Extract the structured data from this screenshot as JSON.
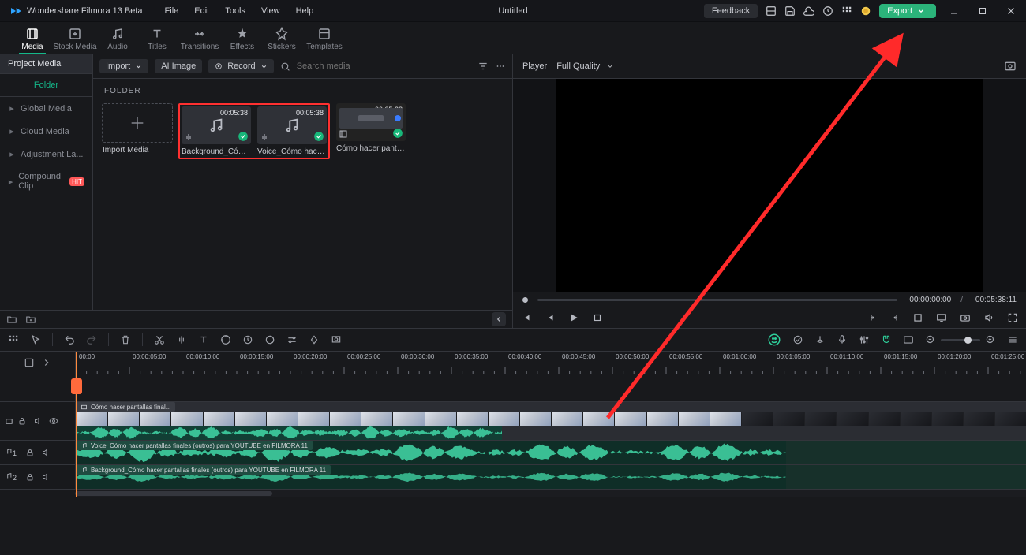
{
  "app": {
    "name": "Wondershare Filmora 13 Beta",
    "document_title": "Untitled"
  },
  "menu": [
    "File",
    "Edit",
    "Tools",
    "View",
    "Help"
  ],
  "titlebar": {
    "feedback": "Feedback",
    "export": "Export"
  },
  "tool_tabs": [
    {
      "label": "Media",
      "icon": "film"
    },
    {
      "label": "Stock Media",
      "icon": "download"
    },
    {
      "label": "Audio",
      "icon": "note"
    },
    {
      "label": "Titles",
      "icon": "text"
    },
    {
      "label": "Transitions",
      "icon": "transition"
    },
    {
      "label": "Effects",
      "icon": "sparkle"
    },
    {
      "label": "Stickers",
      "icon": "sticker"
    },
    {
      "label": "Templates",
      "icon": "template"
    }
  ],
  "side": {
    "head": "Project Media",
    "folder": "Folder",
    "items": [
      {
        "label": "Global Media"
      },
      {
        "label": "Cloud Media"
      },
      {
        "label": "Adjustment La..."
      },
      {
        "label": "Compound Clip",
        "badge": "HIT"
      }
    ]
  },
  "media_tools": {
    "import": "Import",
    "ai_image": "AI Image",
    "record": "Record",
    "search_placeholder": "Search media"
  },
  "media": {
    "folder_label": "FOLDER",
    "cards": [
      {
        "kind": "import",
        "name": "Import Media"
      },
      {
        "kind": "audio",
        "name": "Background_Cómo ha...",
        "dur": "00:05:38"
      },
      {
        "kind": "audio",
        "name": "Voice_Cómo hacer pa...",
        "dur": "00:05:38"
      },
      {
        "kind": "video",
        "name": "Cómo hacer pantallas ...",
        "dur": "00:05:38"
      }
    ]
  },
  "player": {
    "label": "Player",
    "quality": "Full Quality",
    "current": "00:00:00:00",
    "total": "00:05:38:11"
  },
  "ruler": {
    "labels": [
      "00:00",
      "00:00:05:00",
      "00:00:10:00",
      "00:00:15:00",
      "00:00:20:00",
      "00:00:25:00",
      "00:00:30:00",
      "00:00:35:00",
      "00:00:40:00",
      "00:00:45:00",
      "00:00:50:00",
      "00:00:55:00",
      "00:01:00:00",
      "00:01:05:00",
      "00:01:10:00",
      "00:01:15:00",
      "00:01:20:00",
      "00:01:25:00"
    ]
  },
  "tracks": {
    "video_label": "",
    "audio1_label": "1",
    "audio2_label": "2",
    "video_clip": "Cómo hacer pantallas final...",
    "audio1_clip": "Voice_Cómo hacer pantallas finales (outros) para YOUTUBE en FILMORA 11",
    "audio2_clip": "Background_Cómo hacer pantallas finales (outros) para YOUTUBE en FILMORA 11"
  }
}
